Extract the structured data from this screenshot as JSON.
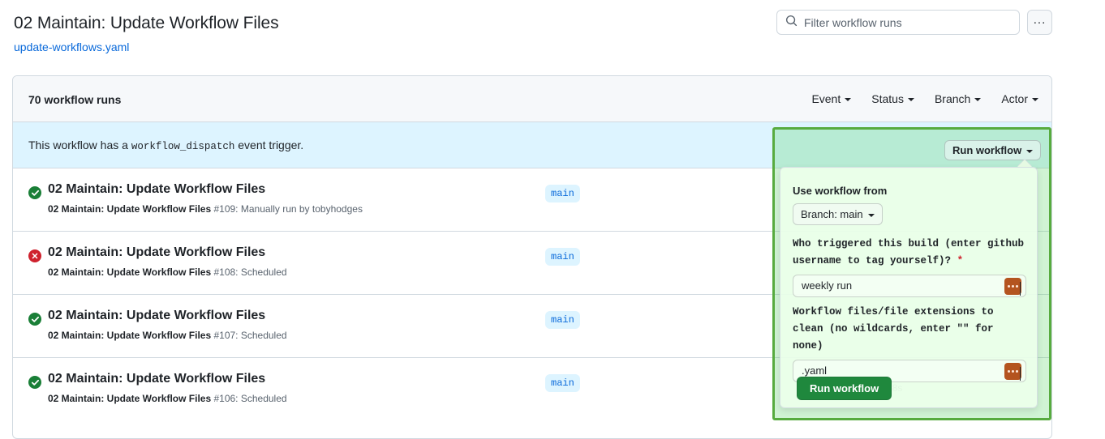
{
  "header": {
    "title": "02 Maintain: Update Workflow Files",
    "file_link": "update-workflows.yaml",
    "search_placeholder": "Filter workflow runs",
    "kebab_label": "...",
    "search_icon": "search-icon"
  },
  "card": {
    "runs_count": "70 workflow runs",
    "filters": [
      {
        "label": "Event"
      },
      {
        "label": "Status"
      },
      {
        "label": "Branch"
      },
      {
        "label": "Actor"
      }
    ]
  },
  "dispatch_banner": {
    "text_before": "This workflow has a",
    "code": "workflow_dispatch",
    "text_after": "event trigger."
  },
  "run_workflow": {
    "button_label": "Run workflow",
    "use_workflow_from_label": "Use workflow from",
    "branch_select_label": "Branch: main",
    "fields": [
      {
        "label": "Who triggered this build (enter github username to tag yourself)?",
        "required": true,
        "value": "weekly run",
        "icon": "password-manager-icon"
      },
      {
        "label": "Workflow files/file extensions to clean (no wildcards, enter \"\" for none)",
        "required": false,
        "value": ".yaml",
        "icon": "password-manager-icon"
      }
    ],
    "submit_label": "Run workflow"
  },
  "runs": [
    {
      "status": "success",
      "title": "02 Maintain: Update Workflow Files",
      "subtitle_bold": "02 Maintain: Update Workflow Files",
      "subtitle_rest": "#109: Manually run by tobyhodges",
      "branch": "main",
      "duration": ""
    },
    {
      "status": "failure",
      "title": "02 Maintain: Update Workflow Files",
      "subtitle_bold": "02 Maintain: Update Workflow Files",
      "subtitle_rest": "#108: Scheduled",
      "branch": "main",
      "duration": ""
    },
    {
      "status": "success",
      "title": "02 Maintain: Update Workflow Files",
      "subtitle_bold": "02 Maintain: Update Workflow Files",
      "subtitle_rest": "#107: Scheduled",
      "branch": "main",
      "duration": ""
    },
    {
      "status": "success",
      "title": "02 Maintain: Update Workflow Files",
      "subtitle_bold": "02 Maintain: Update Workflow Files",
      "subtitle_rest": "#106: Scheduled",
      "branch": "main",
      "duration": "28s"
    }
  ],
  "colors": {
    "accent_blue": "#0969da",
    "success_green": "#1a7f37",
    "failure_red": "#cf222e",
    "highlight_green": "#57ab3f",
    "button_green": "#1f883d",
    "banner_blue": "#ddf4ff"
  }
}
